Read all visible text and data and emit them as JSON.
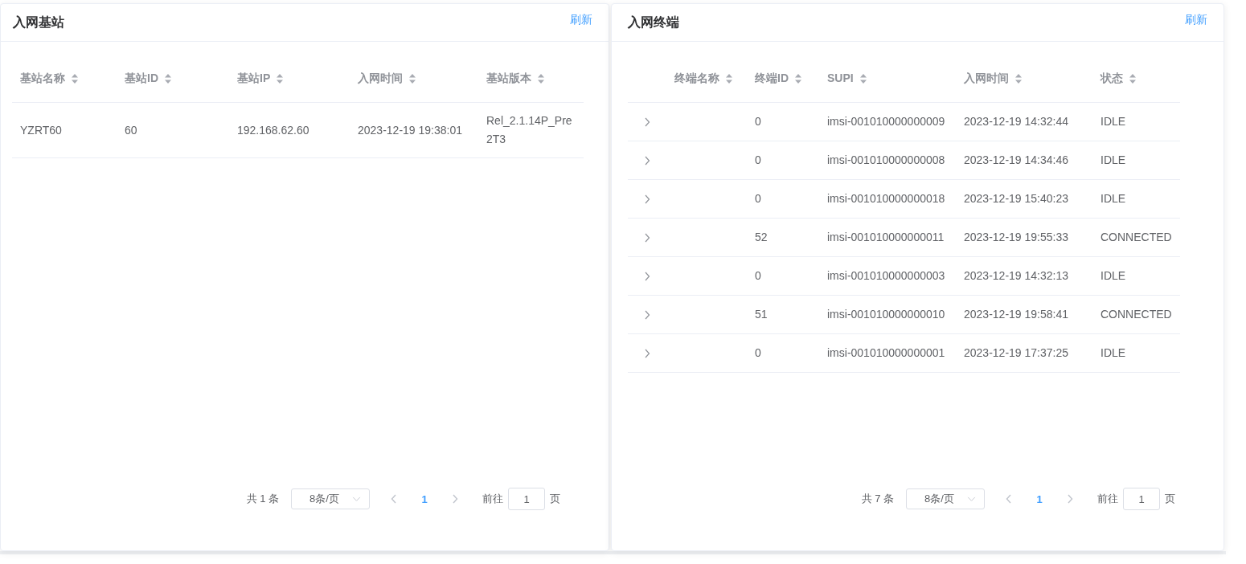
{
  "panels": [
    {
      "title": "入网基站",
      "refresh": "刷新",
      "table": {
        "columns": [
          "基站名称",
          "基站ID",
          "基站IP",
          "入网时间",
          "基站版本"
        ],
        "rows": [
          {
            "cells": [
              "YZRT60",
              "60",
              "192.168.62.60",
              "2023-12-19 19:38:01",
              "Rel_2.1.14P_Pre2T3"
            ]
          }
        ]
      },
      "pagination": {
        "total": "共 1 条",
        "page_size": "8条/页",
        "prev_disabled": true,
        "next_disabled": true,
        "pages": [
          {
            "label": "1",
            "selected": true
          }
        ],
        "goto_label": "前往",
        "goto_value": "1",
        "page_suffix": "页"
      }
    },
    {
      "title": "入网终端",
      "refresh": "刷新",
      "table": {
        "columns": [
          "终端名称",
          "终端ID",
          "SUPI",
          "入网时间",
          "状态"
        ],
        "rows": [
          {
            "expanded": false,
            "cells": [
              "",
              "0",
              "imsi-001010000000009",
              "2023-12-19 14:32:44",
              "IDLE"
            ]
          },
          {
            "expanded": false,
            "cells": [
              "",
              "0",
              "imsi-001010000000008",
              "2023-12-19 14:34:46",
              "IDLE"
            ]
          },
          {
            "expanded": false,
            "cells": [
              "",
              "0",
              "imsi-001010000000018",
              "2023-12-19 15:40:23",
              "IDLE"
            ]
          },
          {
            "expanded": false,
            "cells": [
              "",
              "52",
              "imsi-001010000000011",
              "2023-12-19 19:55:33",
              "CONNECTED"
            ]
          },
          {
            "expanded": false,
            "cells": [
              "",
              "0",
              "imsi-001010000000003",
              "2023-12-19 14:32:13",
              "IDLE"
            ]
          },
          {
            "expanded": false,
            "cells": [
              "",
              "51",
              "imsi-001010000000010",
              "2023-12-19 19:58:41",
              "CONNECTED"
            ]
          },
          {
            "expanded": false,
            "cells": [
              "",
              "0",
              "imsi-001010000000001",
              "2023-12-19 17:37:25",
              "IDLE"
            ]
          }
        ]
      },
      "pagination": {
        "total": "共 7 条",
        "page_size": "8条/页",
        "prev_disabled": true,
        "next_disabled": true,
        "pages": [
          {
            "label": "1",
            "selected": true
          }
        ],
        "goto_label": "前往",
        "goto_value": "1",
        "page_suffix": "页"
      }
    }
  ]
}
